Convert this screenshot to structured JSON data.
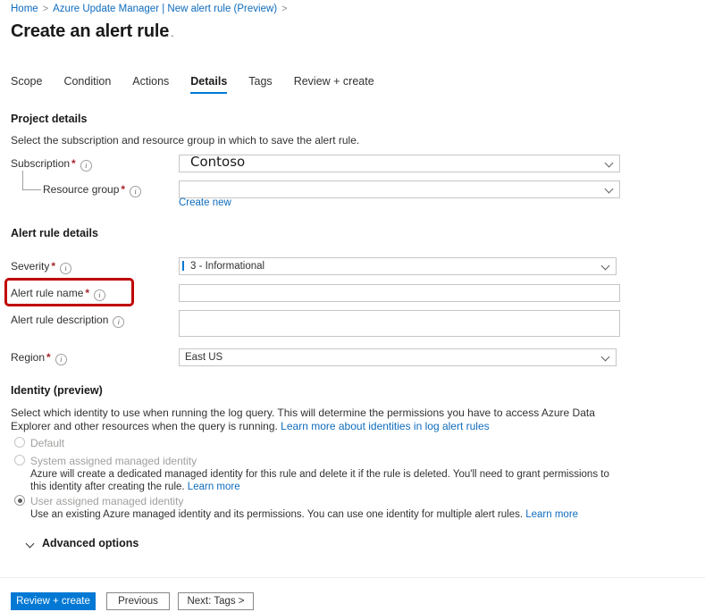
{
  "breadcrumb": {
    "items": [
      "Home",
      "Azure Update Manager | New alert rule (Preview)"
    ],
    "separator": ">"
  },
  "header": {
    "title": "Create an alert rule",
    "ellipsis": "···"
  },
  "tabs": [
    {
      "label": "Scope",
      "active": false
    },
    {
      "label": "Condition",
      "active": false
    },
    {
      "label": "Actions",
      "active": false
    },
    {
      "label": "Details",
      "active": true
    },
    {
      "label": "Tags",
      "active": false
    },
    {
      "label": "Review + create",
      "active": false
    }
  ],
  "project_details": {
    "heading": "Project details",
    "description": "Select the subscription and resource group in which to save the alert rule.",
    "subscription": {
      "label": "Subscription",
      "required": "*",
      "value": "Contoso",
      "placeholder": ""
    },
    "resource_group": {
      "label": "Resource group",
      "required": "*",
      "value": "",
      "placeholder": "",
      "create_new_link": "Create new"
    }
  },
  "alert_rule_details": {
    "heading": "Alert rule details",
    "severity": {
      "label": "Severity",
      "required": "*",
      "value": "3 - Informational"
    },
    "alert_rule_name": {
      "label": "Alert rule name",
      "required": "*",
      "value": "",
      "placeholder": ""
    },
    "alert_rule_description": {
      "label": "Alert rule description",
      "required": "",
      "value": "",
      "placeholder": ""
    },
    "region": {
      "label": "Region",
      "required": "*",
      "value": "East US"
    }
  },
  "identity": {
    "heading": "Identity (preview)",
    "description_part1": "Select which identity to use when running the log query. This will determine the permissions you have to access Azure Data Explorer and other resources when the query is running. ",
    "description_link": "Learn more about identities in log alert rules",
    "options": [
      {
        "label": "Default",
        "selected": false,
        "disabled": true,
        "description": "",
        "link": ""
      },
      {
        "label": "System assigned managed identity",
        "selected": false,
        "disabled": true,
        "description": "Azure will create a dedicated managed identity for this rule and delete it if the rule is deleted. You'll need to grant permissions to this identity after creating the rule. ",
        "link": "Learn more"
      },
      {
        "label": "User assigned managed identity",
        "selected": true,
        "disabled": true,
        "description": "Use an existing Azure managed identity and its permissions. You can use one identity for multiple alert rules. ",
        "link": "Learn more"
      }
    ]
  },
  "advanced_options": {
    "label": "Advanced options",
    "expanded": false
  },
  "footer": {
    "review_create": "Review + create",
    "previous": "Previous",
    "next": "Next: Tags >"
  },
  "colors": {
    "accent_blue": "#0078d4",
    "link_blue": "#0f6cbd",
    "required_red": "#a4262c",
    "annotation_red": "#c00000",
    "border_gray": "#c8c6c4"
  }
}
